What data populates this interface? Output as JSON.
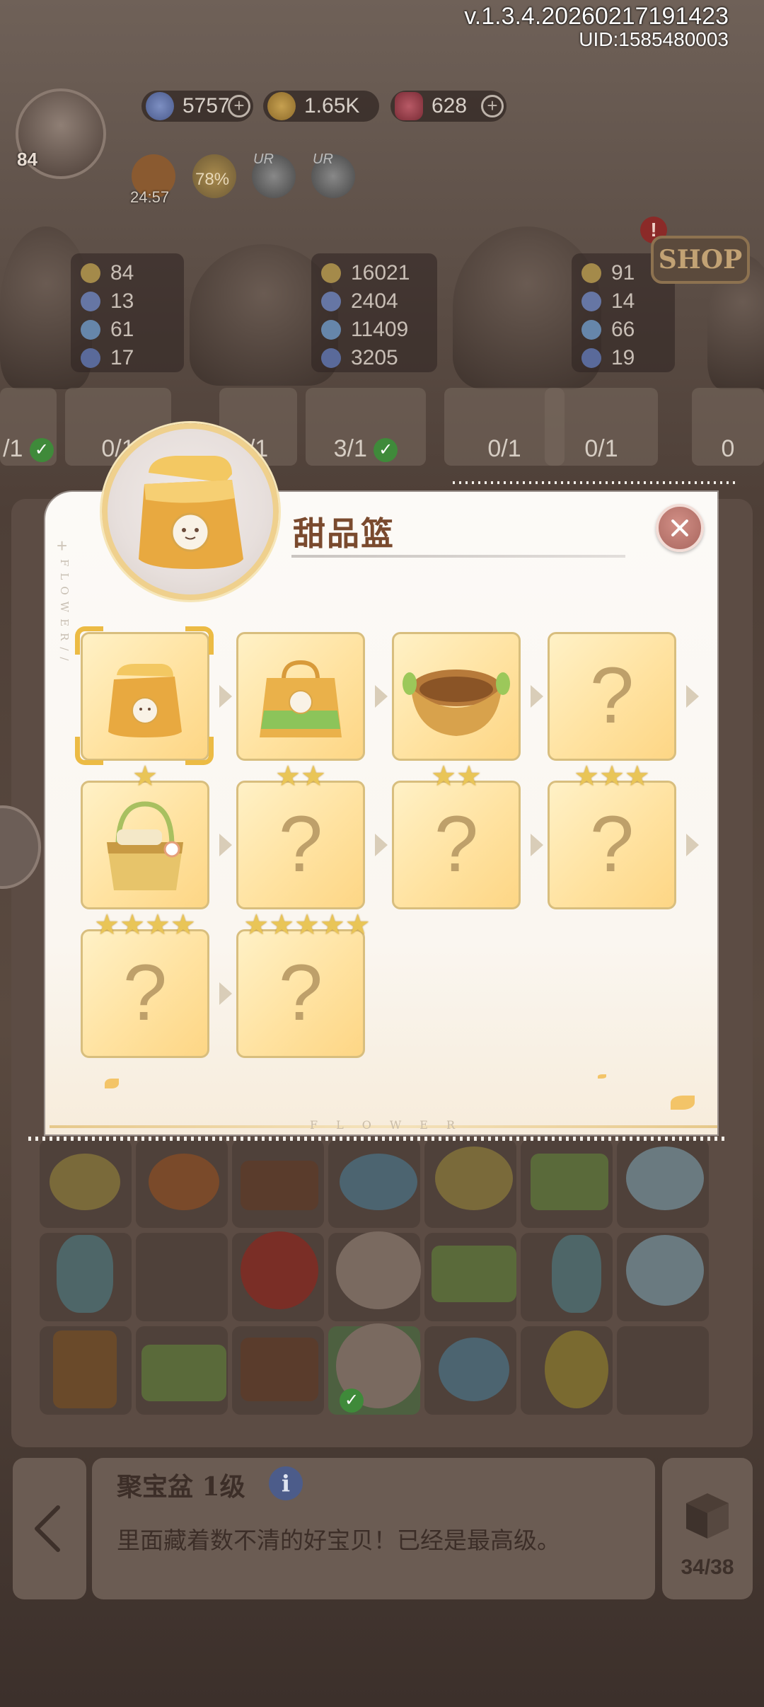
{
  "hud": {
    "version": "v.1.3.4.20260217191423",
    "uid": "UID:1585480003",
    "energy": "5757",
    "coins": "1.65K",
    "gems": "628",
    "player_level": "84",
    "energy_timer": "24:57",
    "progress_percent": "78%",
    "badge_label_1": "UR",
    "badge_label_2": "UR",
    "shop_label": "SHOP",
    "shop_alert": "!"
  },
  "characters": [
    {
      "stats": [
        "84",
        "13",
        "61",
        "17"
      ]
    },
    {
      "stats": [
        "16021",
        "2404",
        "11409",
        "3205"
      ]
    },
    {
      "stats": [
        "91",
        "14",
        "66",
        "19"
      ]
    }
  ],
  "orders": [
    {
      "progress": "/1"
    },
    {
      "progress": "0/1"
    },
    {
      "progress": "/1"
    },
    {
      "progress": "3/1"
    },
    {
      "progress": "0/1"
    },
    {
      "progress": "0/1"
    },
    {
      "progress": "0"
    }
  ],
  "modal": {
    "title": "甜品篮",
    "side_text": "FLOWER//",
    "footer_text": "FLOWER",
    "chain": [
      {
        "known": true,
        "stars": 0,
        "icon": "paper-bag-icon",
        "selected": true
      },
      {
        "known": true,
        "stars": 0,
        "icon": "shopping-bag-icon"
      },
      {
        "known": true,
        "stars": 0,
        "icon": "woven-basket-icon"
      },
      {
        "known": false,
        "stars": 0,
        "label": "?"
      },
      {
        "known": true,
        "stars": 1,
        "icon": "picnic-basket-icon"
      },
      {
        "known": false,
        "stars": 2,
        "label": "?"
      },
      {
        "known": false,
        "stars": 2,
        "label": "?"
      },
      {
        "known": false,
        "stars": 3,
        "label": "?"
      },
      {
        "known": false,
        "stars": 4,
        "label": "?"
      },
      {
        "known": false,
        "stars": 5,
        "label": "?"
      }
    ],
    "star_glyph": "★"
  },
  "bottom": {
    "back_icon": "chevron-left-icon",
    "item_title": "聚宝盆 1级",
    "info_icon_label": "i",
    "item_desc": "里面藏着数不清的好宝贝！已经是最高级。",
    "storage": "34/38"
  },
  "colors": {
    "slot_fill": "#ffe2a0",
    "slot_border": "#d8be7e",
    "title": "#7a4a2e",
    "star": "#e9c557"
  }
}
